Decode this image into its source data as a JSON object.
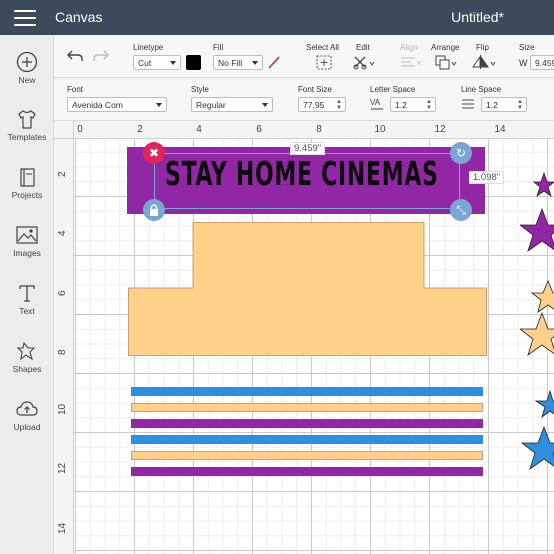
{
  "titlebar": {
    "app": "Canvas",
    "document": "Untitled*"
  },
  "sidebar": {
    "items": [
      {
        "label": "New"
      },
      {
        "label": "Templates"
      },
      {
        "label": "Projects"
      },
      {
        "label": "Images"
      },
      {
        "label": "Text"
      },
      {
        "label": "Shapes"
      },
      {
        "label": "Upload"
      }
    ]
  },
  "toolbar": {
    "linetype_label": "Linetype",
    "linetype_value": "Cut",
    "fill_label": "Fill",
    "fill_value": "No Fill",
    "select_all_label": "Select All",
    "edit_label": "Edit",
    "align_label": "Align",
    "arrange_label": "Arrange",
    "flip_label": "Flip",
    "size_label": "Size",
    "size_w_label": "W",
    "size_w_value": "9.459"
  },
  "textbar": {
    "font_label": "Font",
    "font_value": "Avenida Com",
    "style_label": "Style",
    "style_value": "Regular",
    "fontsize_label": "Font Size",
    "fontsize_value": "77.95",
    "letterspace_label": "Letter Space",
    "letterspace_value": "1.2",
    "linespace_label": "Line Space",
    "linespace_value": "1.2"
  },
  "ruler": {
    "top": [
      "0",
      "2",
      "4",
      "6",
      "8",
      "10",
      "12",
      "14"
    ],
    "left": [
      "2",
      "4",
      "6",
      "8",
      "10",
      "12",
      "14"
    ]
  },
  "canvas": {
    "banner_text": "STAY HOME CINEMAS",
    "width_label": "9.459\"",
    "height_label": "1.098\""
  },
  "colors": {
    "purple": "#9227a6",
    "orange": "#ffd08a",
    "blue": "#2e8fdc",
    "header": "#3c4a5a",
    "fill_swatch": "#000000"
  }
}
